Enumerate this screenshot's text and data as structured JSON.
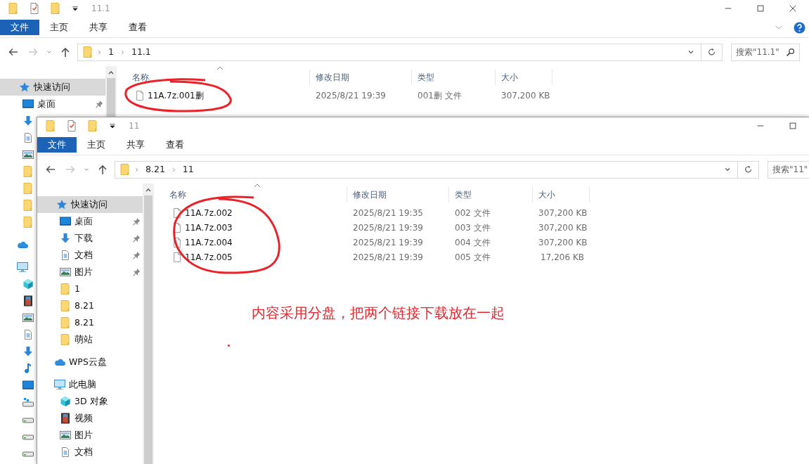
{
  "windows": [
    {
      "title": "11.1",
      "quick_toolbar": [
        {
          "kind": "folder"
        },
        {
          "kind": "properties"
        },
        {
          "kind": "folder"
        }
      ],
      "controls": [
        {
          "kind": "minimize"
        },
        {
          "kind": "maximize"
        },
        {
          "kind": "close"
        }
      ],
      "ribbon_tabs": [
        {
          "label": "文件",
          "selected": true
        },
        {
          "label": "主页",
          "selected": false
        },
        {
          "label": "共享",
          "selected": false
        },
        {
          "label": "查看",
          "selected": false
        }
      ],
      "help_button": true,
      "nav": {
        "back_enabled": true,
        "forward_enabled": false
      },
      "path": [
        "1",
        "11.1"
      ],
      "search": {
        "placeholder": "搜索\"11.1\"",
        "button": true
      },
      "sidebar": [
        {
          "kind": "quick",
          "label": "快速访问",
          "selected": true,
          "children": [
            {
              "kind": "desktop",
              "label": "桌面",
              "pinned": true,
              "selected": false
            },
            {
              "kind": "download",
              "selected": false
            },
            {
              "kind": "document",
              "selected": false
            },
            {
              "kind": "picture",
              "selected": false
            },
            {
              "kind": "folder",
              "selected": false
            },
            {
              "kind": "folder",
              "selected": false
            },
            {
              "kind": "folder",
              "selected": false
            },
            {
              "kind": "folder",
              "selected": false
            }
          ]
        },
        {
          "kind": "cloud",
          "selected": false
        },
        {
          "kind": "pc",
          "selected": false,
          "children": [
            {
              "kind": "cube",
              "selected": false
            },
            {
              "kind": "video",
              "selected": false
            },
            {
              "kind": "picture",
              "selected": false
            },
            {
              "kind": "document",
              "selected": false
            },
            {
              "kind": "download",
              "selected": false
            },
            {
              "kind": "music",
              "selected": false
            },
            {
              "kind": "desktop",
              "selected": false
            },
            {
              "kind": "netdrive",
              "selected": false
            },
            {
              "kind": "drive",
              "selected": false
            },
            {
              "kind": "drive",
              "selected": false
            },
            {
              "kind": "drive",
              "selected": false
            }
          ]
        }
      ],
      "columns": [
        "名称",
        "修改日期",
        "类型",
        "大小"
      ],
      "files": [
        {
          "name": "11A.7z.001删",
          "modified": "2025/8/21 19:39",
          "type": "001删 文件",
          "size": "307,200 KB"
        }
      ],
      "files_circled": true
    },
    {
      "title": "11",
      "quick_toolbar": [
        {
          "kind": "folder"
        },
        {
          "kind": "properties"
        },
        {
          "kind": "folder"
        }
      ],
      "controls": [
        {
          "kind": "minimize"
        },
        {
          "kind": "maximize"
        }
      ],
      "ribbon_tabs": [
        {
          "label": "文件",
          "selected": true
        },
        {
          "label": "主页",
          "selected": false
        },
        {
          "label": "共享",
          "selected": false
        },
        {
          "label": "查看",
          "selected": false
        }
      ],
      "nav": {
        "back_enabled": true,
        "forward_enabled": false
      },
      "path": [
        "8.21",
        "11"
      ],
      "search": {
        "placeholder": "搜索\"11\""
      },
      "sidebar": [
        {
          "kind": "quick",
          "label": "快速访问",
          "selected": true,
          "children": [
            {
              "kind": "desktop",
              "label": "桌面",
              "pinned": true,
              "selected": false
            },
            {
              "kind": "download",
              "label": "下载",
              "pinned": true,
              "selected": false
            },
            {
              "kind": "document",
              "label": "文档",
              "pinned": true,
              "selected": false
            },
            {
              "kind": "picture",
              "label": "图片",
              "pinned": true,
              "selected": false
            },
            {
              "kind": "folder",
              "label": "1",
              "selected": false
            },
            {
              "kind": "folder",
              "label": "8.21",
              "selected": false
            },
            {
              "kind": "folder",
              "label": "8.21",
              "selected": false
            },
            {
              "kind": "folder",
              "label": "萌站",
              "selected": false
            }
          ]
        },
        {
          "kind": "cloud",
          "label": "WPS云盘",
          "selected": false
        },
        {
          "kind": "pc",
          "label": "此电脑",
          "selected": false,
          "children": [
            {
              "kind": "cube",
              "label": "3D 对象",
              "selected": false
            },
            {
              "kind": "video",
              "label": "视频",
              "selected": false
            },
            {
              "kind": "picture",
              "label": "图片",
              "selected": false
            },
            {
              "kind": "document",
              "label": "文档",
              "selected": false
            }
          ]
        }
      ],
      "columns": [
        "名称",
        "修改日期",
        "类型",
        "大小"
      ],
      "files": [
        {
          "name": "11A.7z.002",
          "modified": "2025/8/21 19:35",
          "type": "002 文件",
          "size": "307,200 KB"
        },
        {
          "name": "11A.7z.003",
          "modified": "2025/8/21 19:39",
          "type": "003 文件",
          "size": "307,200 KB"
        },
        {
          "name": "11A.7z.004",
          "modified": "2025/8/21 19:39",
          "type": "004 文件",
          "size": "307,200 KB"
        },
        {
          "name": "11A.7z.005",
          "modified": "2025/8/21 19:39",
          "type": "005 文件",
          "size": "17,206 KB"
        }
      ],
      "files_circled": true,
      "note": "内容采用分盘，把两个链接下载放在一起"
    }
  ]
}
